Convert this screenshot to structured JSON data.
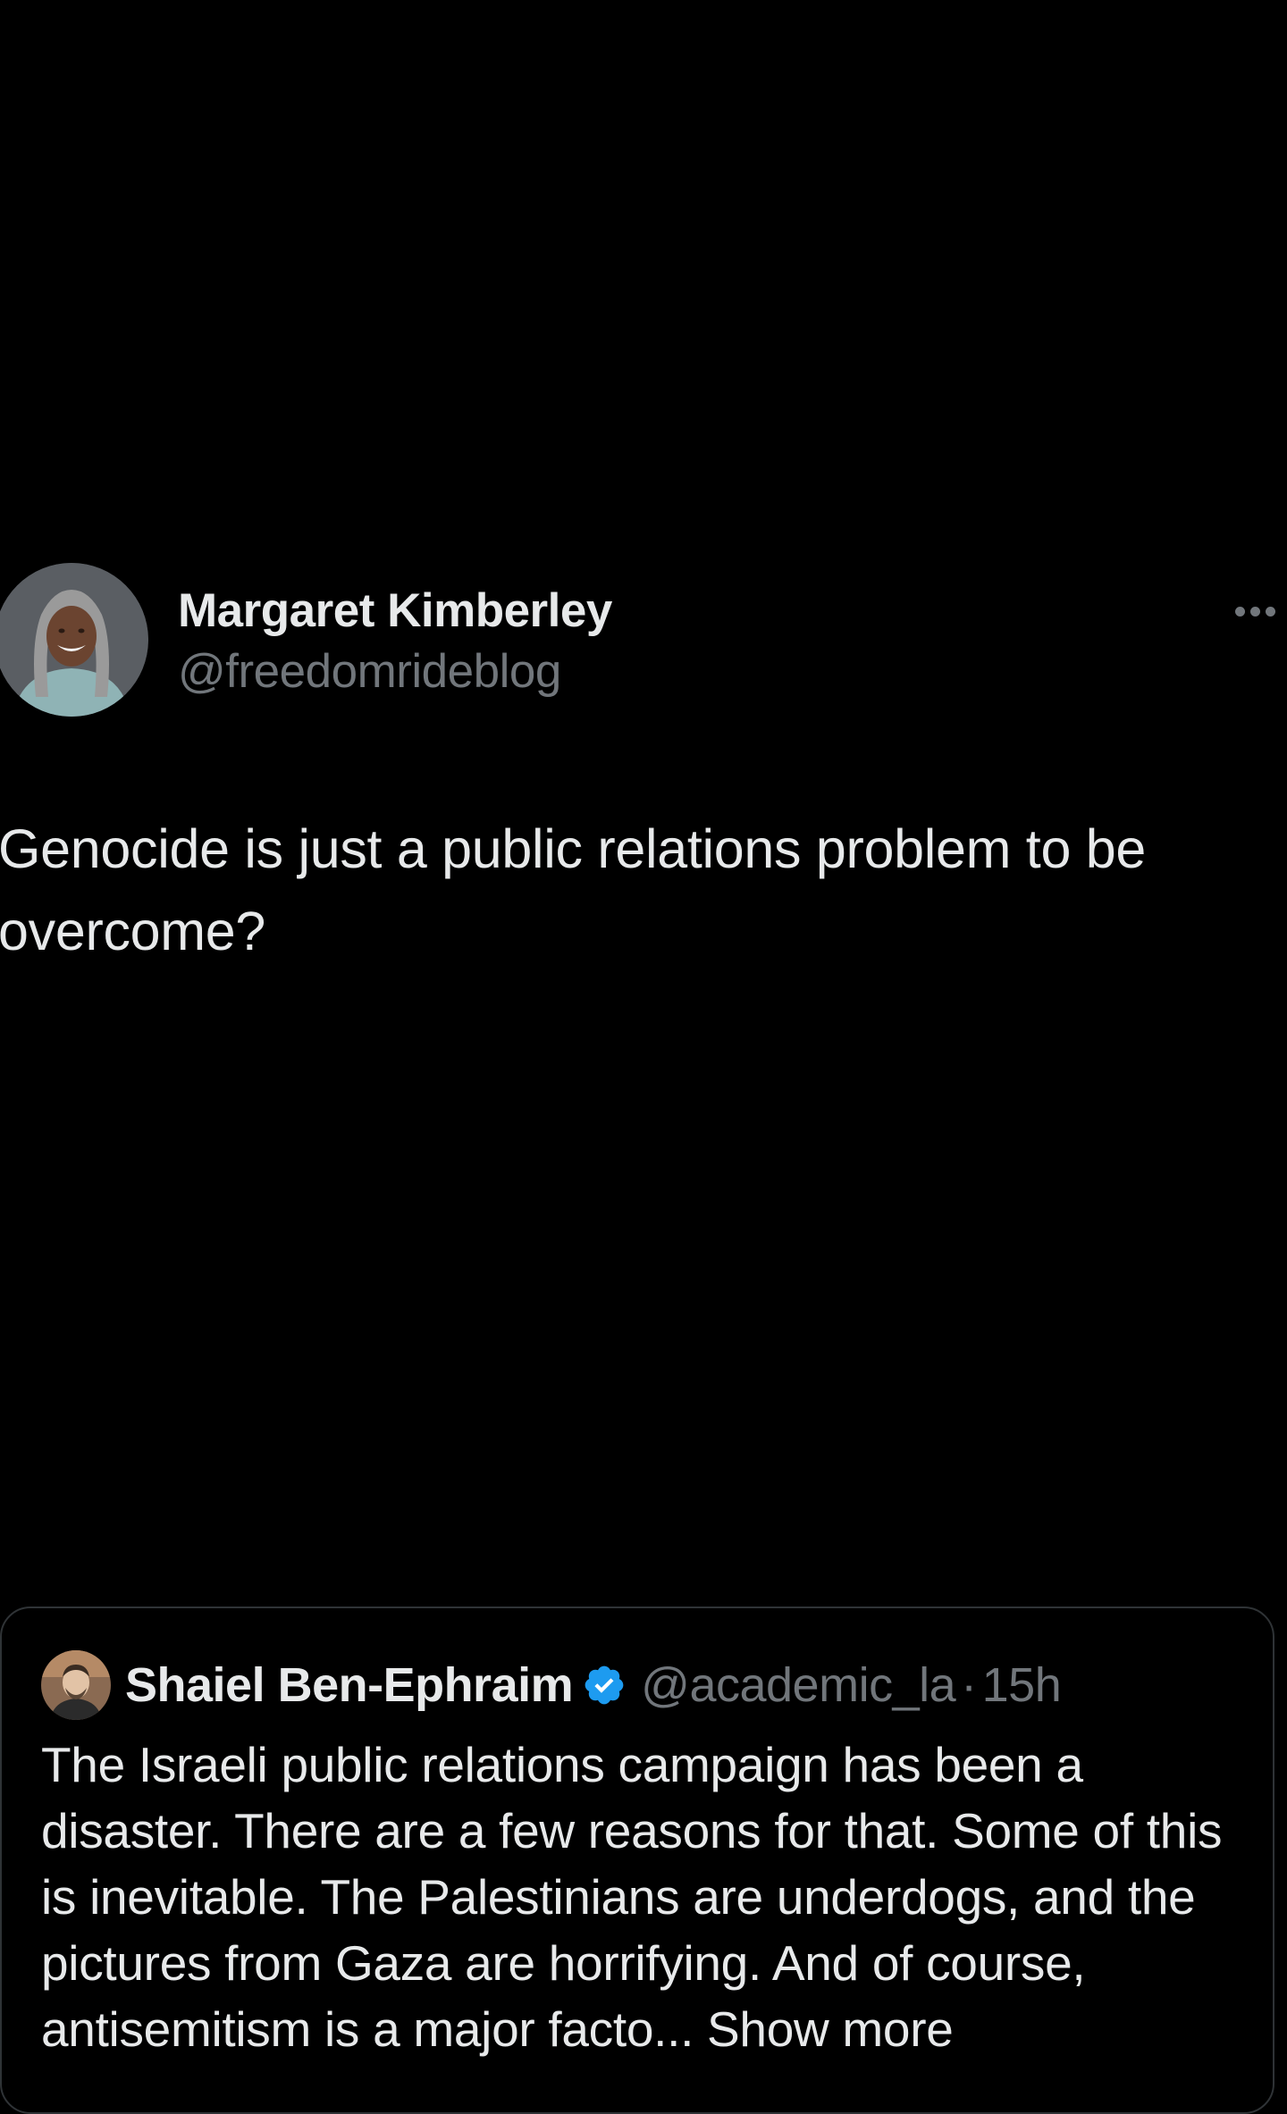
{
  "tweet": {
    "author": {
      "display_name": "Margaret Kimberley",
      "handle": "@freedomrideblog",
      "avatar_icon": "person-avatar"
    },
    "more_icon": "more-horizontal-icon",
    "text": "Genocide is just a public relations problem to be overcome?"
  },
  "quoted_tweet": {
    "author": {
      "display_name": "Shaiel Ben-Ephraim",
      "handle": "@academic_la",
      "verified": true,
      "verified_color": "#1d9bf0",
      "avatar_icon": "person-avatar"
    },
    "separator": "·",
    "time": "15h",
    "text": "The Israeli public relations campaign has been a disaster. There are a few reasons for that. Some of this is inevitable. The Palestinians are underdogs, and the pictures from Gaza are horrifying. And of course, antisemitism is a major facto...",
    "show_more_label": "Show more"
  },
  "colors": {
    "background": "#000000",
    "primary_text": "#e7e9ea",
    "secondary_text": "#71767b",
    "border": "#2f3336",
    "verified": "#1d9bf0"
  }
}
